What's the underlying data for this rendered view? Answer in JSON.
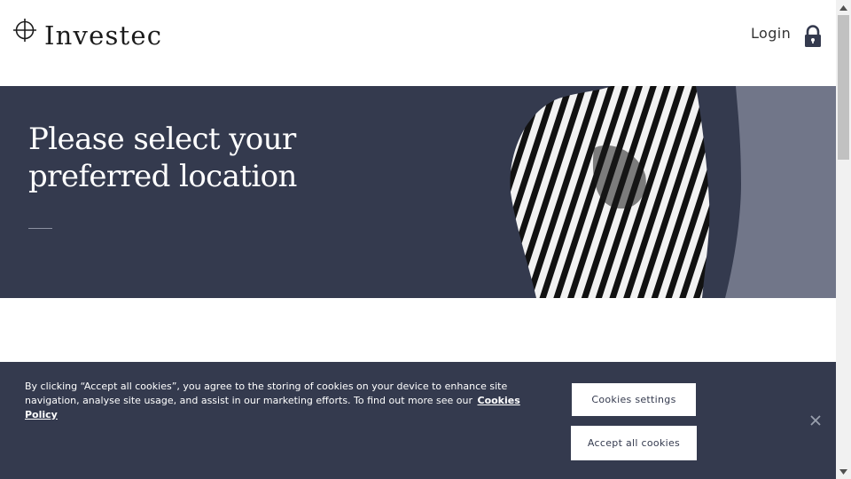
{
  "header": {
    "logo_text": "Investec",
    "login_label": "Login"
  },
  "hero": {
    "title_line1": "Please select your",
    "title_line2": "preferred location"
  },
  "cookie_banner": {
    "text": "By clicking “Accept all cookies”, you agree to the storing of cookies on your device to enhance site navigation, analyse site usage, and assist in our marketing efforts. To find out more see our",
    "policy_link": "Cookies Policy",
    "settings_label": "Cookies settings",
    "accept_label": "Accept all cookies"
  },
  "icons": {
    "logo": "crosshair-logo-icon",
    "login": "lock-icon",
    "close": "close-icon",
    "hero_image": "zebra-image"
  },
  "colors": {
    "navy": "#343a4e",
    "slate": "#717689",
    "text_dark": "#333333",
    "white": "#ffffff"
  }
}
